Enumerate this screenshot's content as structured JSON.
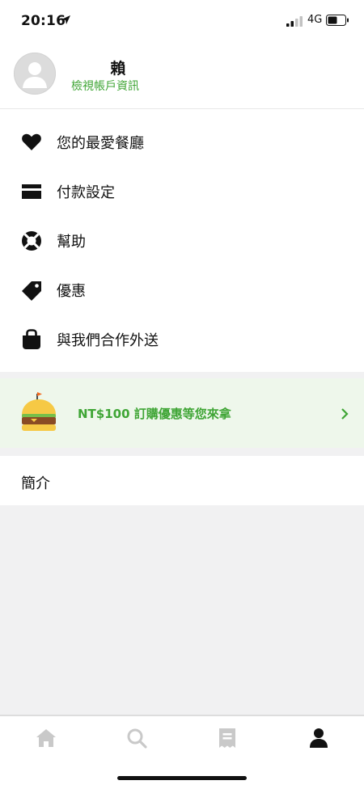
{
  "status": {
    "time": "20:16",
    "network": "4G"
  },
  "profile": {
    "name": "賴",
    "view_account": "檢視帳戶資訊"
  },
  "menu": [
    {
      "label": "您的最愛餐廳",
      "icon": "heart-icon"
    },
    {
      "label": "付款設定",
      "icon": "credit-card-icon"
    },
    {
      "label": "幫助",
      "icon": "lifebuoy-icon"
    },
    {
      "label": "優惠",
      "icon": "tag-icon"
    },
    {
      "label": "與我們合作外送",
      "icon": "delivery-bag-icon"
    }
  ],
  "promo": {
    "text": "NT$100 訂購優惠等您來拿",
    "icon": "burger-icon"
  },
  "intro": {
    "label": "簡介"
  },
  "tabs": [
    {
      "name": "home",
      "icon": "home-icon",
      "active": false
    },
    {
      "name": "search",
      "icon": "search-icon",
      "active": false
    },
    {
      "name": "orders",
      "icon": "receipt-icon",
      "active": false
    },
    {
      "name": "account",
      "icon": "person-icon",
      "active": true
    }
  ],
  "colors": {
    "accent": "#3fa535",
    "promo_bg": "#eef7eb",
    "page_bg": "#f1f1f2",
    "tab_inactive": "#c9c9c9",
    "tab_active": "#111111"
  }
}
